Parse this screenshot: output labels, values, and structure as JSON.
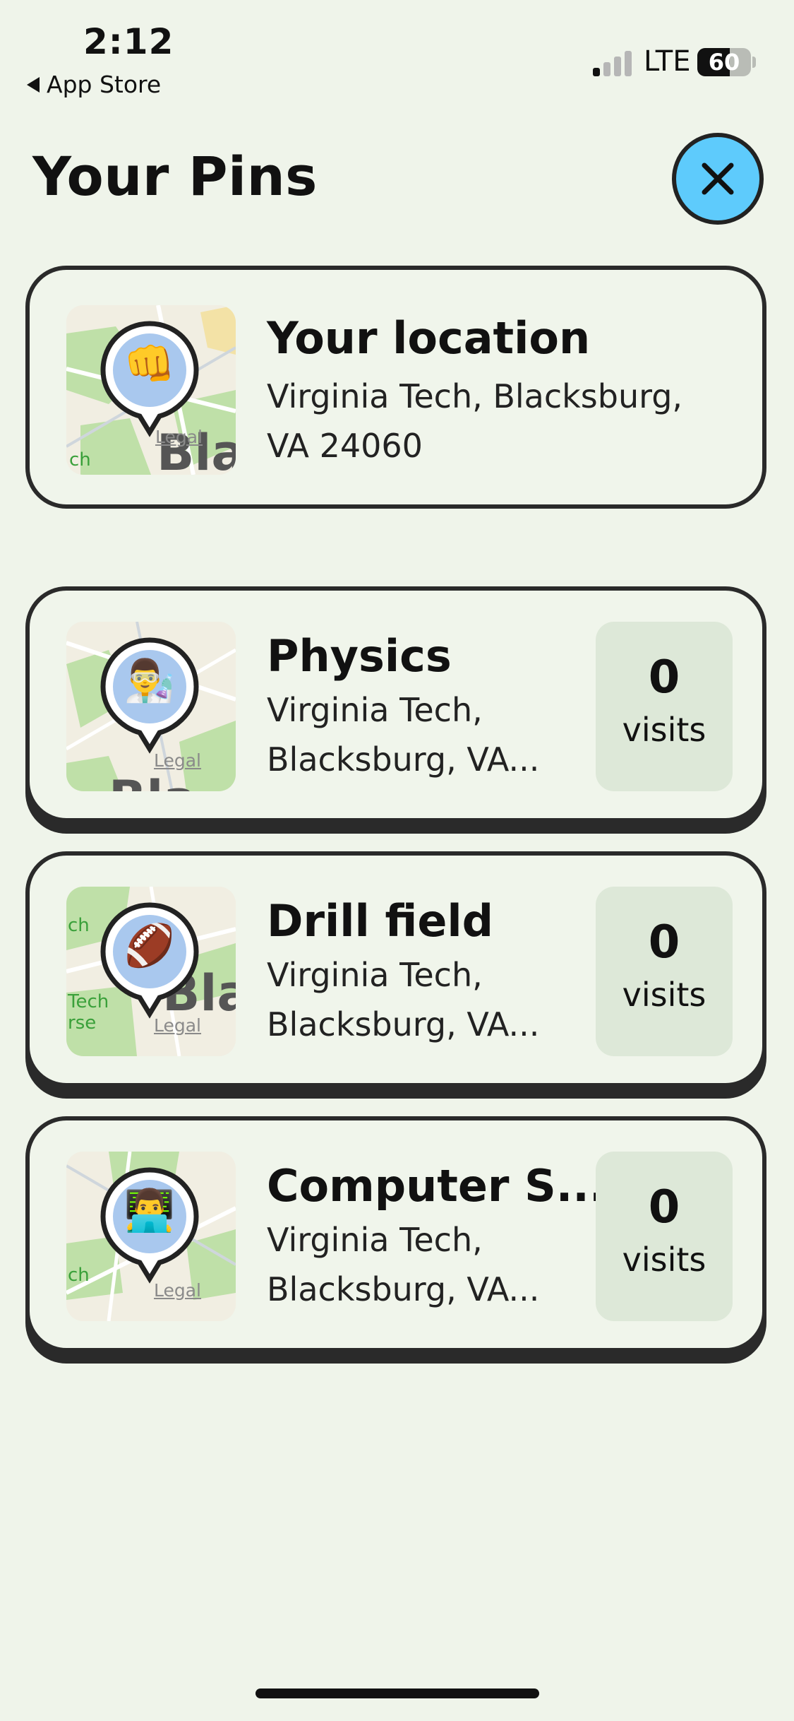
{
  "status_bar": {
    "time": "2:12",
    "back_label": "App Store",
    "network": "LTE",
    "battery": "60",
    "battery_level": 0.6
  },
  "header": {
    "title": "Your Pins"
  },
  "current_location": {
    "title": "Your location",
    "address_line1": "Virginia Tech, Blacksburg,",
    "address_line2": "VA 24060",
    "emoji": "👊",
    "map_legal": "Legal",
    "map_labels": [
      "ch",
      "Bla"
    ]
  },
  "pins": [
    {
      "title": "Physics",
      "address_line1": "Virginia Tech,",
      "address_line2": "Blacksburg, VA...",
      "emoji": "👨‍🔬",
      "visits_count": "0",
      "visits_label": "visits",
      "map_legal": "Legal",
      "map_labels": [
        "",
        "Bla"
      ]
    },
    {
      "title": "Drill field",
      "address_line1": "Virginia Tech,",
      "address_line2": "Blacksburg, VA...",
      "emoji": "🏈",
      "visits_count": "0",
      "visits_label": "visits",
      "map_legal": "Legal",
      "map_labels": [
        "ch",
        "Tech",
        "rse",
        "Bla"
      ]
    },
    {
      "title": "Computer S...",
      "address_line1": "Virginia Tech,",
      "address_line2": "Blacksburg, VA...",
      "emoji": "👨‍💻",
      "visits_count": "0",
      "visits_label": "visits",
      "map_legal": "Legal",
      "map_labels": [
        "ch"
      ]
    }
  ],
  "colors": {
    "background": "#eff4ea",
    "close_button": "#5ecbfc",
    "card_border": "#2a2a2a",
    "visits_box": "#dde8d8"
  }
}
